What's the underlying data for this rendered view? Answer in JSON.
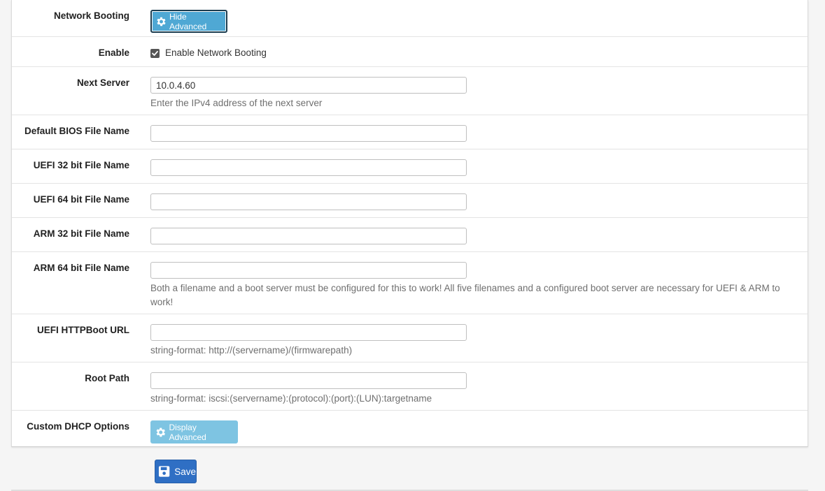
{
  "rows": {
    "network_booting": {
      "label": "Network Booting",
      "button_label": "Hide Advanced"
    },
    "enable": {
      "label": "Enable",
      "checkbox_label": "Enable Network Booting",
      "checked": true
    },
    "next_server": {
      "label": "Next Server",
      "value": "10.0.4.60",
      "help": "Enter the IPv4 address of the next server"
    },
    "bios": {
      "label": "Default BIOS File Name",
      "value": ""
    },
    "uefi32": {
      "label": "UEFI 32 bit File Name",
      "value": ""
    },
    "uefi64": {
      "label": "UEFI 64 bit File Name",
      "value": ""
    },
    "arm32": {
      "label": "ARM 32 bit File Name",
      "value": ""
    },
    "arm64": {
      "label": "ARM 64 bit File Name",
      "value": "",
      "help_line1": "Both a filename and a boot server must be configured for this to work! All five filenames and a configured boot server are necessary for UEFI & ARM to",
      "help_line2": "work!"
    },
    "httpboot": {
      "label": "UEFI HTTPBoot URL",
      "value": "",
      "help": "string-format: http://(servername)/(firmwarepath)"
    },
    "root_path": {
      "label": "Root Path",
      "value": "",
      "help": "string-format: iscsi:(servername):(protocol):(port):(LUN):targetname"
    },
    "custom_dhcp": {
      "label": "Custom DHCP Options",
      "button_label": "Display Advanced"
    }
  },
  "actions": {
    "save_label": "Save"
  },
  "icons": {
    "advanced_button_icon": "gear-icon",
    "save_button_icon": "floppy-disk-icon",
    "checkbox_icon": "check-icon"
  },
  "colors": {
    "hide_advanced_button": "#4fa8d4",
    "display_advanced_button": "#7ec4e2",
    "save_button": "#2f6fc4"
  }
}
